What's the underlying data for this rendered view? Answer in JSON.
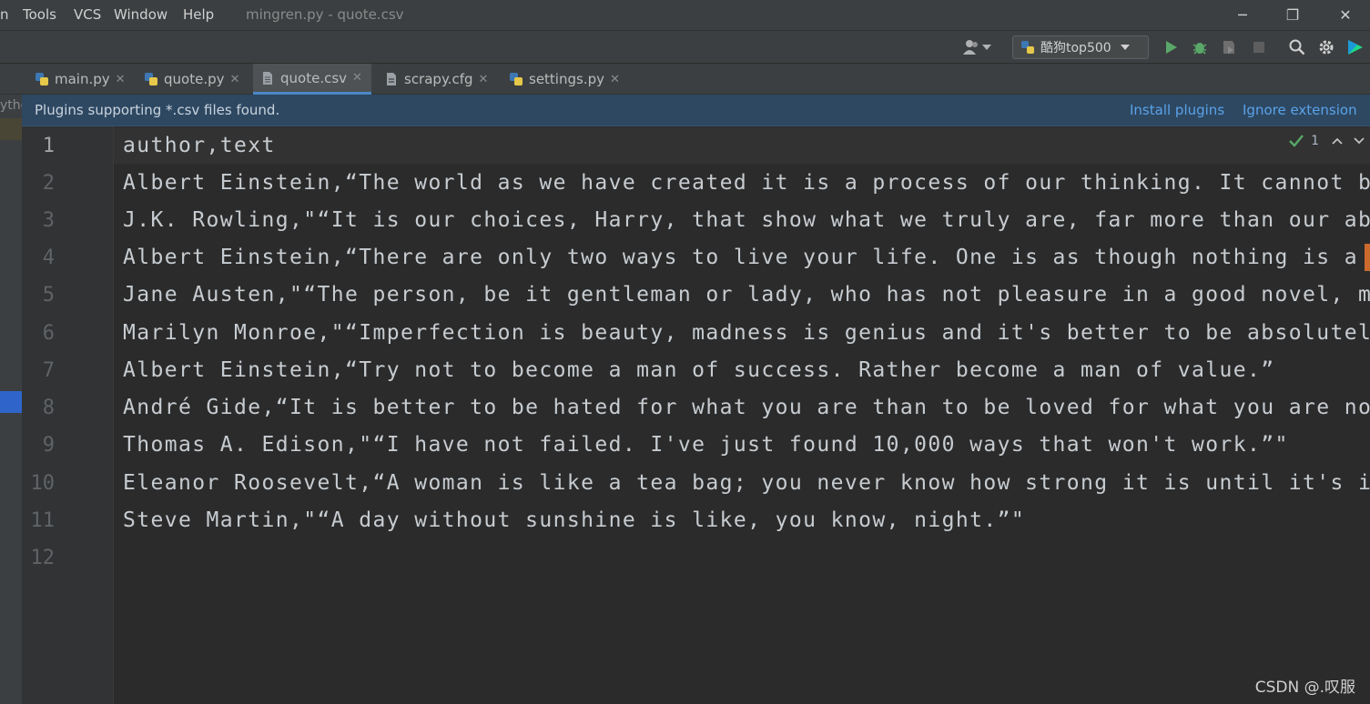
{
  "menu": {
    "items": [
      "n",
      "Tools",
      "VCS",
      "Window",
      "Help"
    ],
    "title": "mingren.py - quote.csv"
  },
  "window_controls": {
    "minimize": "─",
    "restore": "❐",
    "close": "✕"
  },
  "toolbar": {
    "run_config_label": "酷狗top500",
    "icons": [
      "user-icon",
      "python-icon",
      "chevron-down-icon",
      "run-icon",
      "debug-icon",
      "coverage-icon",
      "stop-icon",
      "search-icon",
      "gear-icon",
      "plugin-logo-icon"
    ]
  },
  "tabs": [
    {
      "label": "main.py",
      "icon": "python-file-icon",
      "active": false
    },
    {
      "label": "quote.py",
      "icon": "python-file-icon",
      "active": false
    },
    {
      "label": "quote.csv",
      "icon": "csv-file-icon",
      "active": true
    },
    {
      "label": "scrapy.cfg",
      "icon": "config-file-icon",
      "active": false
    },
    {
      "label": "settings.py",
      "icon": "python-file-icon",
      "active": false
    }
  ],
  "left_strip_text": "ytho",
  "notification": {
    "message": "Plugins supporting *.csv files found.",
    "install_label": "Install plugins",
    "ignore_label": "Ignore extension"
  },
  "inspection": {
    "count": "1"
  },
  "editor": {
    "line_numbers": [
      "1",
      "2",
      "3",
      "4",
      "5",
      "6",
      "7",
      "8",
      "9",
      "10",
      "11",
      "12"
    ],
    "lines": [
      "author,text",
      "Albert Einstein,“The world as we have created it is a process of our thinking. It cannot be",
      "J.K. Rowling,\"“It is our choices, Harry, that show what we truly are, far more than our abil",
      "Albert Einstein,“There are only two ways to live your life. One is as though nothing is a mi",
      "Jane Austen,\"“The person, be it gentleman or lady, who has not pleasure in a good novel, mus",
      "Marilyn Monroe,\"“Imperfection is beauty, madness is genius and it's better to be absolutely",
      "Albert Einstein,“Try not to become a man of success. Rather become a man of value.”",
      "André Gide,“It is better to be hated for what you are than to be loved for what you are not.",
      "Thomas A. Edison,\"“I have not failed. I've just found 10,000 ways that won't work.”\"",
      "Eleanor Roosevelt,“A woman is like a tea bag; you never know how strong it is until it's in",
      "Steve Martin,\"“A day without sunshine is like, you know, night.”\"",
      ""
    ]
  },
  "watermark": "CSDN @.叹服",
  "colors": {
    "accent": "#4a88c7",
    "notification_bg": "#2e4862",
    "link": "#5aa2e8",
    "run_green": "#59a869"
  }
}
